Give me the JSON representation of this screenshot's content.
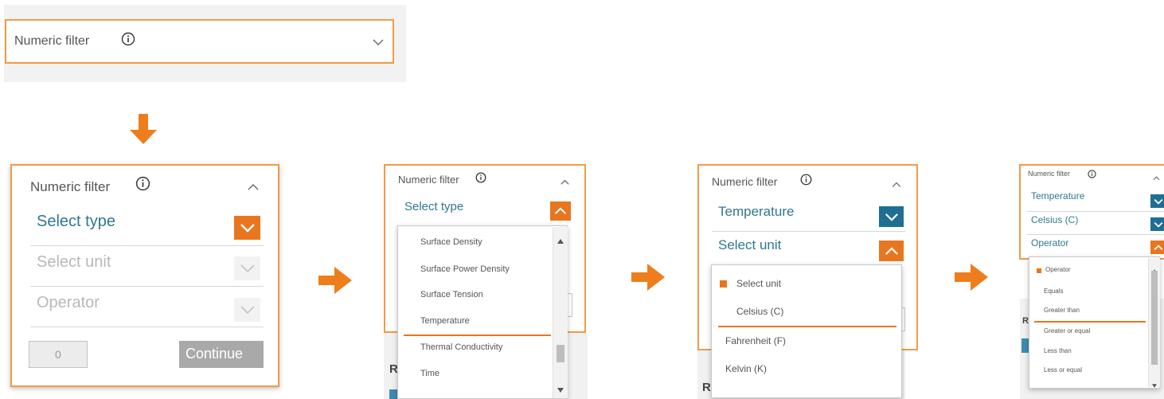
{
  "top": {
    "label": "Numeric filter",
    "info_icon": "info-circle-icon",
    "toggle_icon": "chevron-down-icon"
  },
  "panel1": {
    "label": "Numeric filter",
    "select_type": "Select type",
    "select_unit": "Select unit",
    "operator": "Operator",
    "value": "0",
    "continue": "Continue",
    "accent": "#e8761e"
  },
  "panel2": {
    "label": "Numeric filter",
    "select_type": "Select type",
    "options": [
      "Surface Density",
      "Surface Power Density",
      "Surface Tension",
      "Temperature",
      "Thermal Conductivity",
      "Time"
    ],
    "partial_letter": "R"
  },
  "panel3": {
    "label": "Numeric filter",
    "type_value": "Temperature",
    "select_unit": "Select unit",
    "options": [
      "Select unit",
      "Celsius (C)",
      "Fahrenheit (F)",
      "Kelvin (K)"
    ],
    "partial_letter": "R"
  },
  "panel4": {
    "label": "Numeric filter",
    "type_value": "Temperature",
    "unit_value": "Celsius (C)",
    "operator": "Operator",
    "options": [
      "Operator",
      "Equals",
      "Greater than",
      "Greater or equal",
      "Less than",
      "Less or equal"
    ],
    "partial_letter": "R"
  },
  "colors": {
    "orange": "#e8761e",
    "teal": "#2f7891",
    "blue_btn": "#1f6f94"
  }
}
